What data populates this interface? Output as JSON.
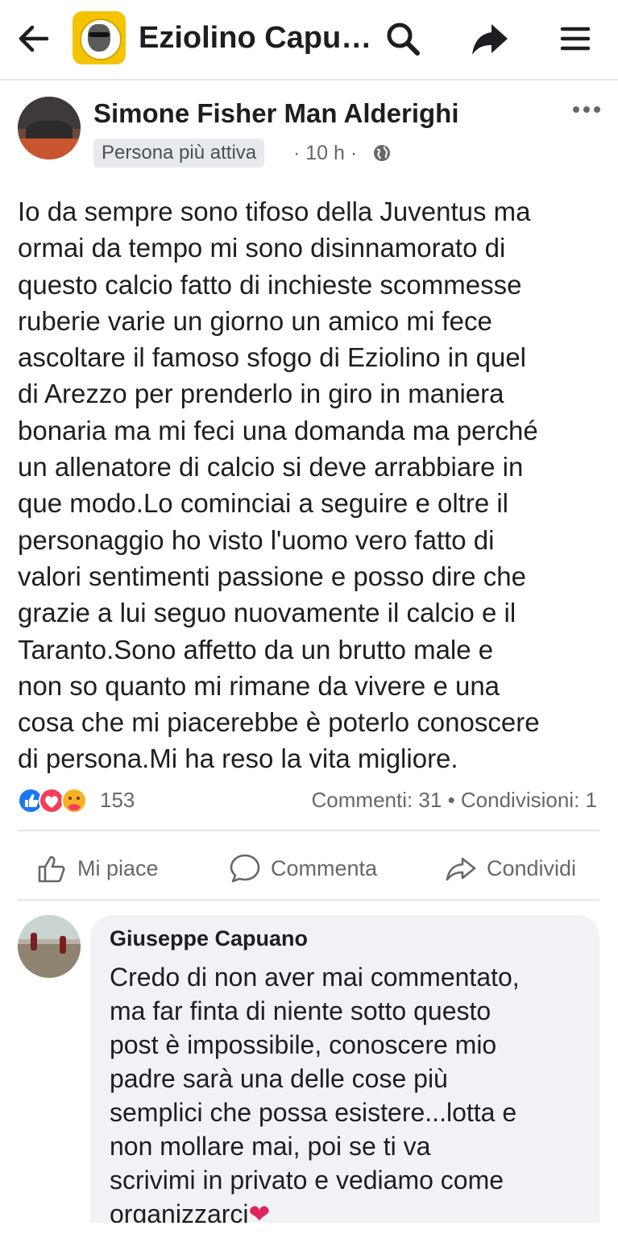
{
  "header": {
    "title": "Eziolino Capu…",
    "back_icon": "arrow-left-icon",
    "search_icon": "search-icon",
    "share_icon": "share-arrow-icon",
    "menu_icon": "hamburger-menu-icon"
  },
  "post": {
    "author": "Simone Fisher Man Alderighi",
    "badge": "Persona più attiva",
    "time": "· 10 h ·",
    "privacy_icon": "globe-icon",
    "more_icon": "more-dots-icon",
    "lines": [
      "Io da sempre sono tifoso della Juventus ma",
      "ormai da tempo mi sono disinnamorato di",
      "questo calcio fatto di inchieste scommesse",
      "ruberie varie un giorno un amico mi fece",
      "ascoltare il famoso sfogo di Eziolino in quel",
      "di Arezzo per prenderlo in giro in maniera",
      "bonaria ma mi feci una domanda ma perché",
      "un allenatore di calcio si deve arrabbiare in",
      "que modo.Lo cominciai a seguire e oltre il",
      "personaggio ho visto l'uomo vero fatto di",
      "valori sentimenti passione e posso dire che",
      "grazie a lui seguo nuovamente il calcio e il",
      "Taranto.Sono affetto da un brutto male e",
      "non so quanto mi rimane da vivere e una",
      "cosa che mi piacerebbe è poterlo conoscere",
      "di persona.Mi ha reso la vita migliore."
    ],
    "reactions": {
      "icons": [
        "like-reaction-icon",
        "love-reaction-icon",
        "care-reaction-icon"
      ],
      "count": "153"
    },
    "stats": "Commenti: 31 • Condivisioni: 1"
  },
  "actions": {
    "like": "Mi piace",
    "comment": "Commenta",
    "share": "Condividi"
  },
  "comment": {
    "author": "Giuseppe Capuano",
    "lines": [
      "Credo di non aver mai commentato,",
      "ma far finta di niente sotto questo",
      "post è impossibile, conoscere mio",
      "padre sarà una delle cose più",
      "semplici che possa esistere...lotta e",
      "non mollare mai, poi se ti va",
      "scrivimi in privato e vediamo come",
      "organizzarci"
    ],
    "emoji": "❤"
  }
}
